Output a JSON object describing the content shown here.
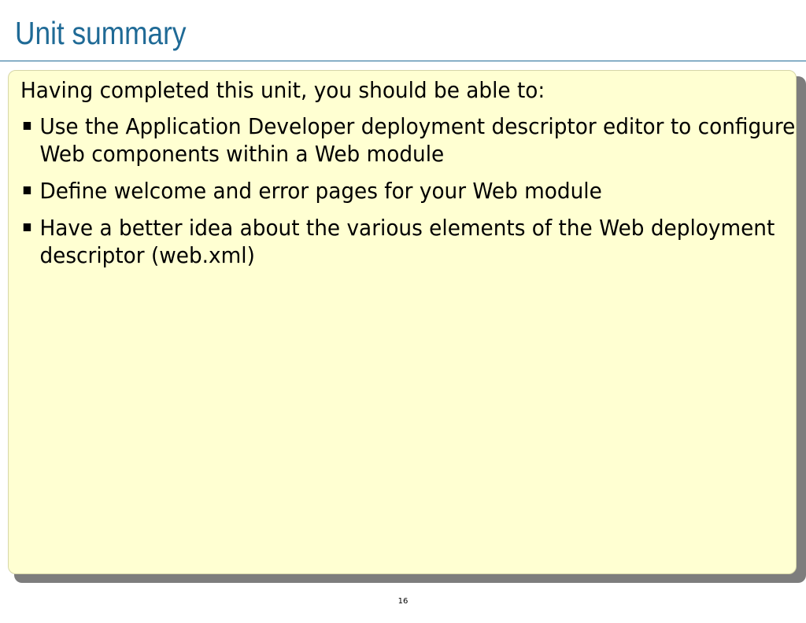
{
  "slide": {
    "title": "Unit summary",
    "intro": "Having completed this unit, you should be able to:",
    "bullets": [
      "Use the Application Developer deployment descriptor editor to configure Web components within a Web module",
      "Define welcome and error pages for your Web module",
      "Have a better idea about the various elements of the Web deployment descriptor (web.xml)"
    ],
    "page_number": "16"
  },
  "colors": {
    "title": "#1f6a96",
    "content_background": "#ffffd2",
    "shadow": "#7d7d7d"
  }
}
